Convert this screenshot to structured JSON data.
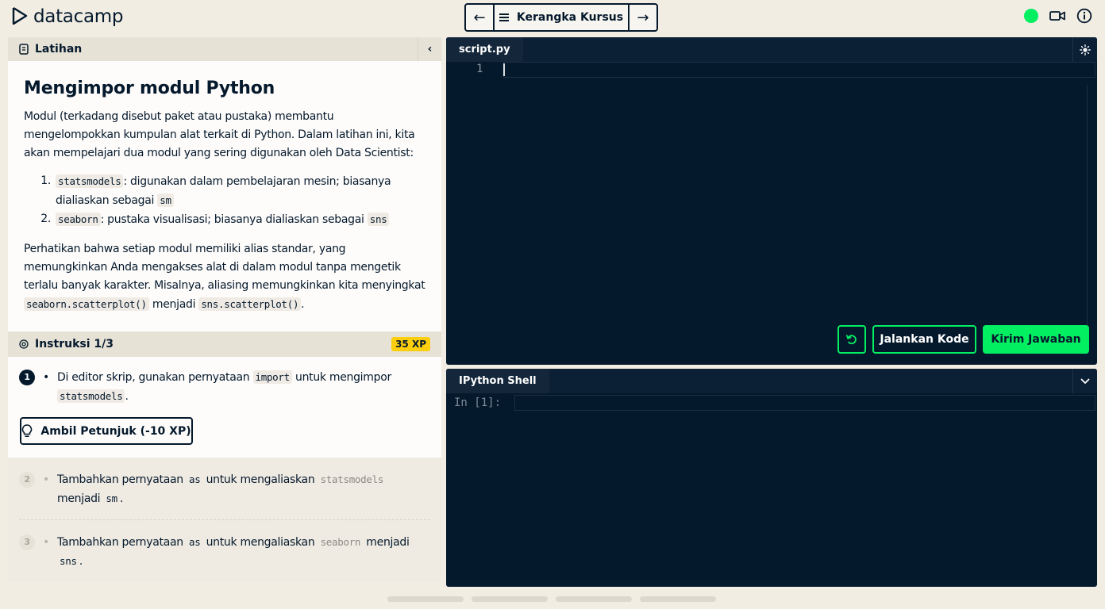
{
  "header": {
    "logo_text": "datacamp",
    "course_outline_label": "Kerangka Kursus",
    "prev_icon": "arrow-left-icon",
    "next_icon": "arrow-right-icon",
    "menu_icon": "hamburger-icon",
    "status_color": "#03ef62",
    "video_icon": "video-camera-icon",
    "info_icon": "info-icon"
  },
  "exercise": {
    "section_label": "Latihan",
    "title": "Mengimpor modul Python",
    "intro": "Modul (terkadang disebut paket atau pustaka) membantu mengelompokkan kumpulan alat terkait di Python. Dalam latihan ini, kita akan mempelajari dua modul yang sering digunakan oleh Data Scientist:",
    "list": [
      {
        "num": "1.",
        "code": "statsmodels",
        "text": ": digunakan dalam pembelajaran mesin; biasanya dialiaskan sebagai ",
        "code2": "sm"
      },
      {
        "num": "2.",
        "code": "seaborn",
        "text": ": pustaka visualisasi; biasanya dialiaskan sebagai ",
        "code2": "sns"
      }
    ],
    "note_text": "Perhatikan bahwa setiap modul memiliki alias standar, yang memungkinkan Anda mengakses alat di dalam modul tanpa mengetik terlalu banyak karakter. Misalnya, aliasing memungkinkan kita menyingkat",
    "note_code1": "seaborn.scatterplot()",
    "note_mid": " menjadi ",
    "note_code2": "sns.scatterplot()",
    "note_end": "."
  },
  "instructions": {
    "label": "Instruksi 1/3",
    "xp": "35 XP",
    "steps": [
      {
        "num": "1",
        "text_a": "Di editor skrip, gunakan pernyataan ",
        "code_a": "import",
        "text_b": " untuk mengimpor ",
        "code_b": "statsmodels",
        "text_c": "."
      },
      {
        "num": "2",
        "text_a": "Tambahkan pernyataan ",
        "code_a": "as",
        "text_b": " untuk mengaliaskan ",
        "code_b": "statsmodels",
        "text_c": " menjadi ",
        "code_c": "sm",
        "text_d": "."
      },
      {
        "num": "3",
        "text_a": "Tambahkan pernyataan ",
        "code_a": "as",
        "text_b": " untuk mengaliaskan ",
        "code_b": "seaborn",
        "text_c": " menjadi ",
        "code_c": "sns",
        "text_d": "."
      }
    ],
    "hint_label": "Ambil Petunjuk (-10 XP)",
    "accent_color": "#fcce0d"
  },
  "editor": {
    "tab_label": "script.py",
    "line_number": "1",
    "run_label": "Jalankan Kode",
    "submit_label": "Kirim Jawaban",
    "accent_color": "#03ef62"
  },
  "shell": {
    "tab_label": "IPython Shell",
    "prompt": "In [1]:"
  }
}
